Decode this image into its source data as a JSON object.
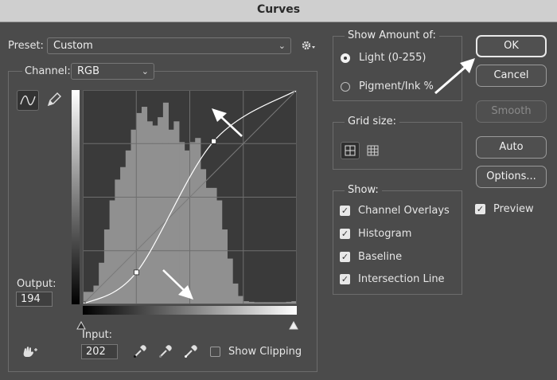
{
  "window": {
    "title": "Curves"
  },
  "preset": {
    "label": "Preset:",
    "value": "Custom"
  },
  "channel": {
    "label": "Channel:",
    "value": "RGB"
  },
  "output": {
    "label": "Output:",
    "value": "194"
  },
  "input": {
    "label": "Input:",
    "value": "202"
  },
  "show_clipping": {
    "label": "Show Clipping",
    "checked": false
  },
  "show_amount": {
    "title": "Show Amount of:",
    "options": [
      {
        "label": "Light  (0-255)",
        "selected": true
      },
      {
        "label": "Pigment/Ink %",
        "selected": false
      }
    ]
  },
  "grid_size": {
    "title": "Grid size:",
    "options": [
      "simple-grid-icon",
      "detailed-grid-icon"
    ],
    "selected": "simple-grid-icon"
  },
  "show": {
    "title": "Show:",
    "items": [
      {
        "label": "Channel Overlays",
        "checked": true
      },
      {
        "label": "Histogram",
        "checked": true
      },
      {
        "label": "Baseline",
        "checked": true
      },
      {
        "label": "Intersection Line",
        "checked": true
      }
    ]
  },
  "buttons": {
    "ok": "OK",
    "cancel": "Cancel",
    "smooth": "Smooth",
    "auto": "Auto",
    "options": "Options..."
  },
  "preview": {
    "label": "Preview",
    "checked": true
  },
  "curve": {
    "points": [
      [
        0,
        0
      ],
      [
        64,
        38
      ],
      [
        156,
        194
      ],
      [
        255,
        255
      ]
    ]
  },
  "histogram": {
    "levels": [
      0.06,
      0.06,
      0.09,
      0.2,
      0.36,
      0.5,
      0.6,
      0.66,
      0.74,
      0.84,
      0.92,
      0.95,
      0.88,
      0.86,
      0.9,
      0.97,
      0.84,
      0.88,
      0.78,
      0.74,
      0.78,
      0.8,
      0.65,
      0.56,
      0.56,
      0.5,
      0.36,
      0.22,
      0.1,
      0.04,
      0.015,
      0.012,
      0.01,
      0.01,
      0.01,
      0.01,
      0.01,
      0.01,
      0.012,
      0.015
    ]
  },
  "colors": {
    "accent": "#e9e9e9",
    "background": "#4b4b4b",
    "histogram": "#909090",
    "plot": "#3a3a3a"
  }
}
